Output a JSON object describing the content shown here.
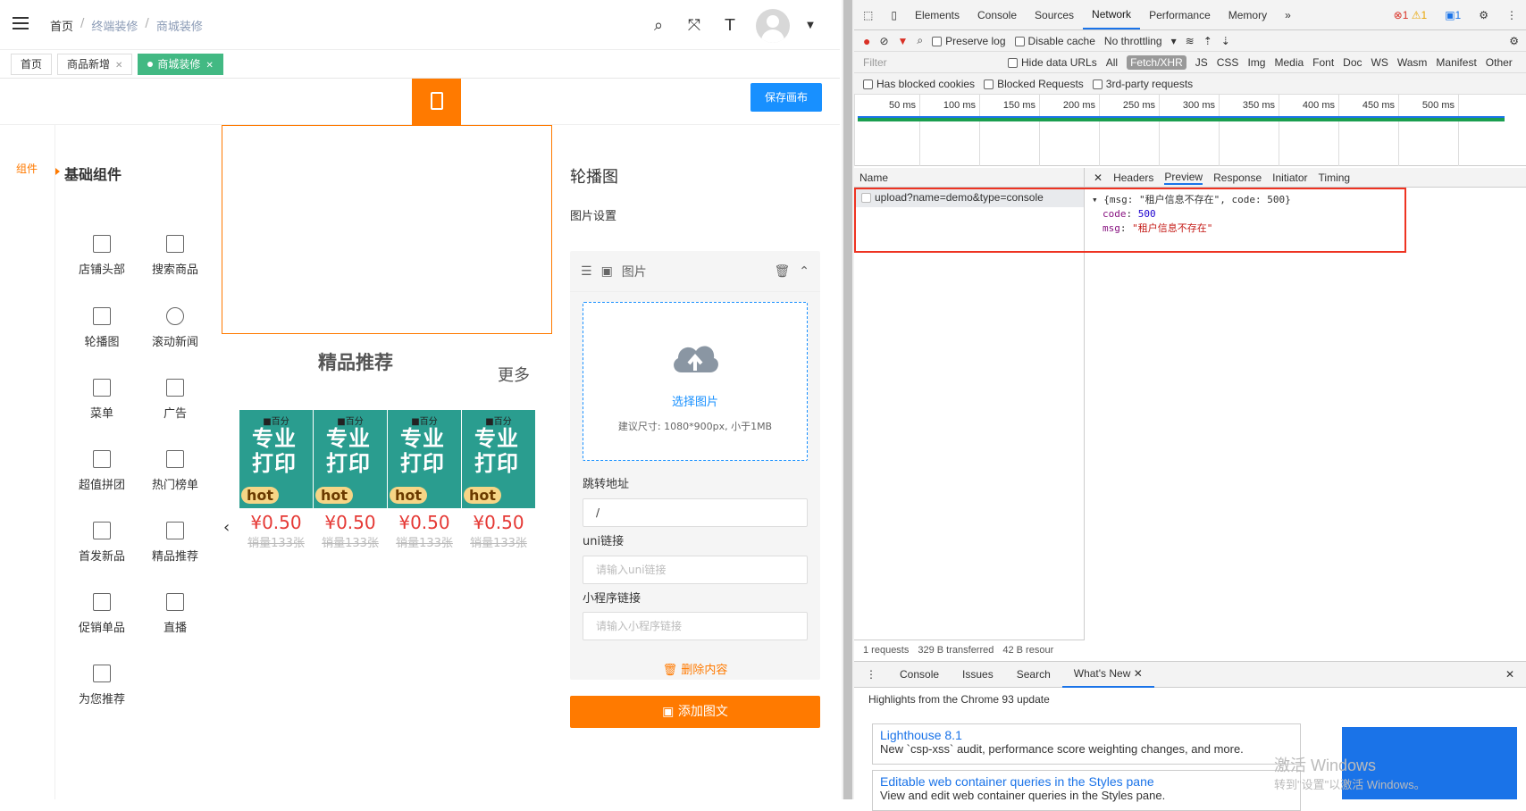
{
  "header": {
    "breadcrumb": [
      "首页",
      "终端装修",
      "商城装修"
    ]
  },
  "tabs": [
    {
      "label": "首页"
    },
    {
      "label": "商品新增"
    },
    {
      "label": "商城装修"
    }
  ],
  "toolbar": {
    "save_label": "保存画布"
  },
  "sidebar": {
    "rail_label": "组件",
    "section_title": "基础组件",
    "items": [
      "店铺头部",
      "搜索商品",
      "轮播图",
      "滚动新闻",
      "菜单",
      "广告",
      "超值拼团",
      "热门榜单",
      "首发新品",
      "精品推荐",
      "促销单品",
      "直播",
      "为您推荐"
    ]
  },
  "preview": {
    "section_title": "精品推荐",
    "more_label": "更多",
    "products": [
      {
        "banner_top": "■百分",
        "banner_big": "专业打印",
        "badge": "hot",
        "price": "¥0.50",
        "sales": "销量133张"
      },
      {
        "banner_top": "■百分",
        "banner_big": "专业打印",
        "badge": "hot",
        "price": "¥0.50",
        "sales": "销量133张"
      },
      {
        "banner_top": "■百分",
        "banner_big": "专业打印",
        "badge": "hot",
        "price": "¥0.50",
        "sales": "销量133张"
      },
      {
        "banner_top": "■百分",
        "banner_big": "专业打印",
        "badge": "hot",
        "price": "¥0.50",
        "sales": "销量133张"
      }
    ]
  },
  "settings": {
    "title": "轮播图",
    "subtitle": "图片设置",
    "card_label": "图片",
    "upload_link": "选择图片",
    "upload_hint": "建议尺寸: 1080*900px, 小于1MB",
    "jump_label": "跳转地址",
    "jump_value": "/",
    "uni_label": "uni链接",
    "uni_placeholder": "请输入uni链接",
    "mini_label": "小程序链接",
    "mini_placeholder": "请输入小程序链接",
    "delete_label": "删除内容",
    "add_label": "添加图文"
  },
  "devtools": {
    "tabs": [
      "Elements",
      "Console",
      "Sources",
      "Network",
      "Performance",
      "Memory"
    ],
    "active_tab": "Network",
    "error_count": "1",
    "warning_count": "1",
    "message_count": "1",
    "preserve_log": "Preserve log",
    "disable_cache": "Disable cache",
    "throttling": "No throttling",
    "filter_placeholder": "Filter",
    "hide_data_urls": "Hide data URLs",
    "type_filters": [
      "All",
      "Fetch/XHR",
      "JS",
      "CSS",
      "Img",
      "Media",
      "Font",
      "Doc",
      "WS",
      "Wasm",
      "Manifest",
      "Other"
    ],
    "active_filter": "Fetch/XHR",
    "blocked_cookies": "Has blocked cookies",
    "blocked_requests": "Blocked Requests",
    "third_party": "3rd-party requests",
    "timeline_ticks": [
      "50 ms",
      "100 ms",
      "150 ms",
      "200 ms",
      "250 ms",
      "300 ms",
      "350 ms",
      "400 ms",
      "450 ms",
      "500 ms"
    ],
    "name_header": "Name",
    "request": "upload?name=demo&type=console",
    "detail_tabs": [
      "Headers",
      "Preview",
      "Response",
      "Initiator",
      "Timing"
    ],
    "active_detail": "Preview",
    "json_summary": "{msg: \"租户信息不存在\", code: 500}",
    "code_key": "code",
    "code_value": "500",
    "msg_key": "msg",
    "msg_value": "\"租户信息不存在\"",
    "status": [
      "1 requests",
      "329 B transferred",
      "42 B resour"
    ],
    "drawer_tabs": [
      "Console",
      "Issues",
      "Search",
      "What's New"
    ],
    "highlights": "Highlights from the Chrome 93 update",
    "news": [
      {
        "title": "Lighthouse 8.1",
        "desc": "New `csp-xss` audit, performance score weighting changes, and more."
      },
      {
        "title": "Editable web container queries in the Styles pane",
        "desc": "View and edit web container queries in the Styles pane."
      }
    ],
    "watermark1": "激活 Windows",
    "watermark2": "转到\"设置\"以激活 Windows。"
  },
  "colors": {
    "accent": "#ff7a00",
    "primary": "#1890ff",
    "success": "#42b983"
  }
}
